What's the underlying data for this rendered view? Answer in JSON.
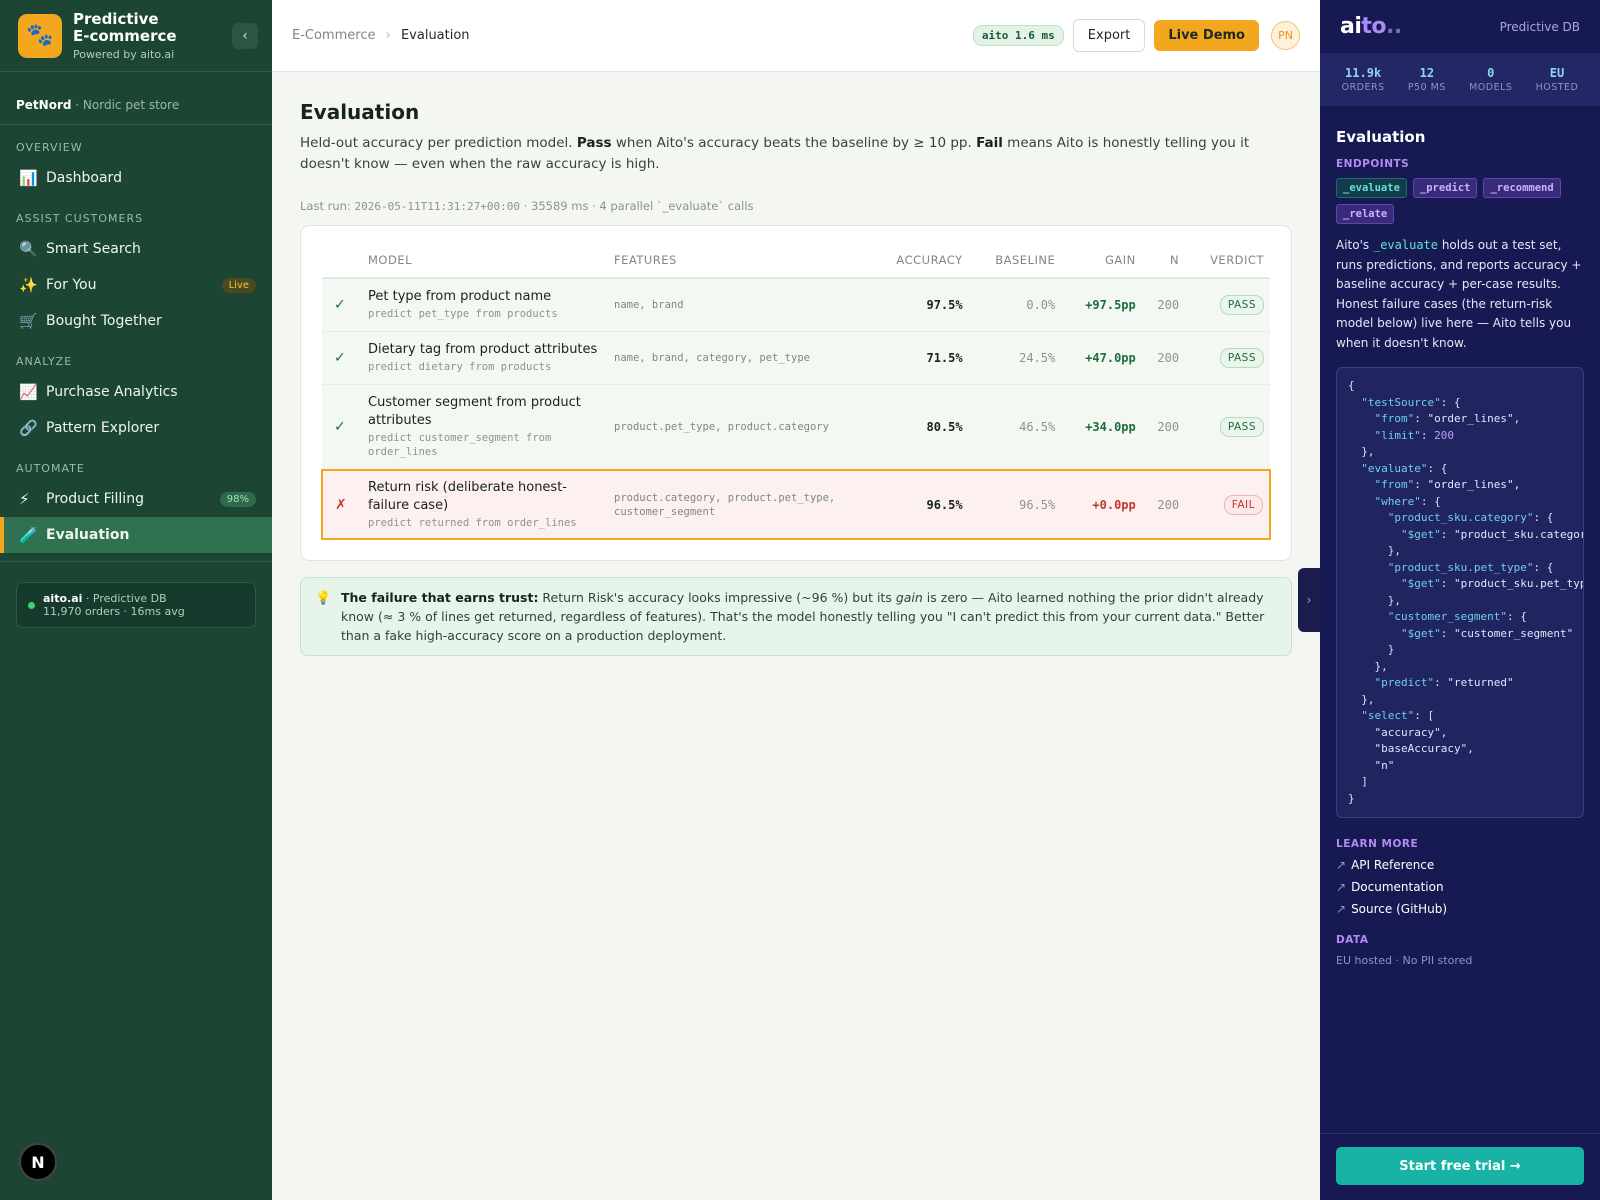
{
  "sidebar": {
    "brand_title_line1": "Predictive",
    "brand_title_line2": "E-commerce",
    "brand_sub": "Powered by aito.ai",
    "collapse": "‹",
    "tenant_name": "PetNord",
    "tenant_desc": "· Nordic pet store",
    "sections": {
      "overview": "OVERVIEW",
      "assist": "ASSIST CUSTOMERS",
      "analyze": "ANALYZE",
      "automate": "AUTOMATE"
    },
    "items": {
      "dashboard": "Dashboard",
      "smart_search": "Smart Search",
      "for_you": "For You",
      "for_you_badge": "Live",
      "bought_together": "Bought Together",
      "purchase_analytics": "Purchase Analytics",
      "pattern_explorer": "Pattern Explorer",
      "product_filling": "Product Filling",
      "product_filling_badge": "98%",
      "evaluation": "Evaluation"
    },
    "db_card": {
      "name": "aito.ai",
      "type": "· Predictive DB",
      "stats": "11,970 orders · 16ms avg"
    },
    "next_badge": "N"
  },
  "topbar": {
    "breadcrumb_parent": "E-Commerce",
    "breadcrumb_sep": "›",
    "breadcrumb_current": "Evaluation",
    "latency": "aito 1.6 ms",
    "export": "Export",
    "live_demo": "Live Demo",
    "avatar": "PN"
  },
  "main": {
    "title": "Evaluation",
    "desc_1": "Held-out accuracy per prediction model. ",
    "desc_pass": "Pass",
    "desc_2": " when Aito's accuracy beats the baseline by ≥ 10 pp. ",
    "desc_fail": "Fail",
    "desc_3": " means Aito is honestly telling you it doesn't know — even when the raw accuracy is high.",
    "meta_prefix": "Last run: ",
    "meta_timestamp": "2026-05-11T11:31:27+00:00",
    "meta_suffix": " · 35589 ms · 4 parallel `_evaluate` calls",
    "columns": [
      "MODEL",
      "FEATURES",
      "ACCURACY",
      "BASELINE",
      "GAIN",
      "N",
      "VERDICT"
    ],
    "rows": [
      {
        "mark": "✓",
        "name": "Pet type from product name",
        "sub": "predict pet_type from products",
        "features": "name, brand",
        "accuracy": "97.5%",
        "baseline": "0.0%",
        "gain": "+97.5pp",
        "n": "200",
        "verdict": "PASS"
      },
      {
        "mark": "✓",
        "name": "Dietary tag from product attributes",
        "sub": "predict dietary from products",
        "features": "name, brand, category, pet_type",
        "accuracy": "71.5%",
        "baseline": "24.5%",
        "gain": "+47.0pp",
        "n": "200",
        "verdict": "PASS"
      },
      {
        "mark": "✓",
        "name": "Customer segment from product attributes",
        "sub": "predict customer_segment from order_lines",
        "features": "product.pet_type, product.category",
        "accuracy": "80.5%",
        "baseline": "46.5%",
        "gain": "+34.0pp",
        "n": "200",
        "verdict": "PASS"
      },
      {
        "mark": "✗",
        "name": "Return risk (deliberate honest-failure case)",
        "sub": "predict returned from order_lines",
        "features": "product.category, product.pet_type, customer_segment",
        "accuracy": "96.5%",
        "baseline": "96.5%",
        "gain": "+0.0pp",
        "n": "200",
        "verdict": "FAIL"
      }
    ],
    "note_bold": "The failure that earns trust:",
    "note_1": " Return Risk's accuracy looks impressive (~96 %) but its ",
    "note_em": "gain",
    "note_2": " is zero — Aito learned nothing the prior didn't already know (≈ 3 % of lines get returned, regardless of features). That's the model honestly telling you \"I can't predict this from your current data.\" Better than a fake high-accuracy score on a production deployment."
  },
  "drawer_toggle": "›",
  "panel": {
    "logo_ai": "ai",
    "logo_to": "to",
    "logo_dots": "..",
    "header_sub": "Predictive DB",
    "stats": [
      {
        "value": "11.9k",
        "label": "ORDERS"
      },
      {
        "value": "12",
        "label": "P50 MS"
      },
      {
        "value": "0",
        "label": "MODELS"
      },
      {
        "value": "EU",
        "label": "HOSTED"
      }
    ],
    "title": "Evaluation",
    "endpoints_label": "ENDPOINTS",
    "endpoints": [
      "_evaluate",
      "_predict",
      "_recommend",
      "_relate"
    ],
    "desc_1": "Aito's ",
    "desc_code": "_evaluate",
    "desc_2": " holds out a test set, runs predictions, and reports accuracy + baseline accuracy + per-case results. Honest failure cases (the return-risk model below) live here — Aito tells you when it doesn't know.",
    "code": {
      "test_source_key": "\"testSource\"",
      "from_key": "\"from\"",
      "order_lines": "\"order_lines\"",
      "limit_key": "\"limit\"",
      "limit_val": "200",
      "evaluate_key": "\"evaluate\"",
      "where_key": "\"where\"",
      "cat_key": "\"product_sku.category\"",
      "get_key": "\"$get\"",
      "cat_val": "\"product_sku.category\"",
      "pt_key": "\"product_sku.pet_type\"",
      "pt_val": "\"product_sku.pet_type\"",
      "seg_key": "\"customer_segment\"",
      "seg_val": "\"customer_segment\"",
      "predict_key": "\"predict\"",
      "predict_val": "\"returned\"",
      "select_key": "\"select\"",
      "sel_1": "\"accuracy\"",
      "sel_2": "\"baseAccuracy\"",
      "sel_3": "\"n\""
    },
    "learn_label": "LEARN MORE",
    "links": [
      "API Reference",
      "Documentation",
      "Source (GitHub)"
    ],
    "data_label": "DATA",
    "data_note": "EU hosted · No PII stored",
    "cta": "Start free trial →"
  },
  "colors": {
    "sidebar_bg": "#1c4534",
    "accent": "#f2a71f",
    "panel_bg": "#171a52",
    "pass": "#1e6b3e",
    "fail": "#c0392b",
    "cta": "#18b3a5"
  },
  "icons": {
    "brand": "paw-icon",
    "dashboard": "bar-chart-icon",
    "smart_search": "magnifier-icon",
    "for_you": "sparkles-icon",
    "bought_together": "cart-icon",
    "purchase_analytics": "line-chart-icon",
    "pattern_explorer": "link-icon",
    "product_filling": "lightning-icon",
    "evaluation": "test-tube-icon",
    "note": "lightbulb-icon"
  }
}
